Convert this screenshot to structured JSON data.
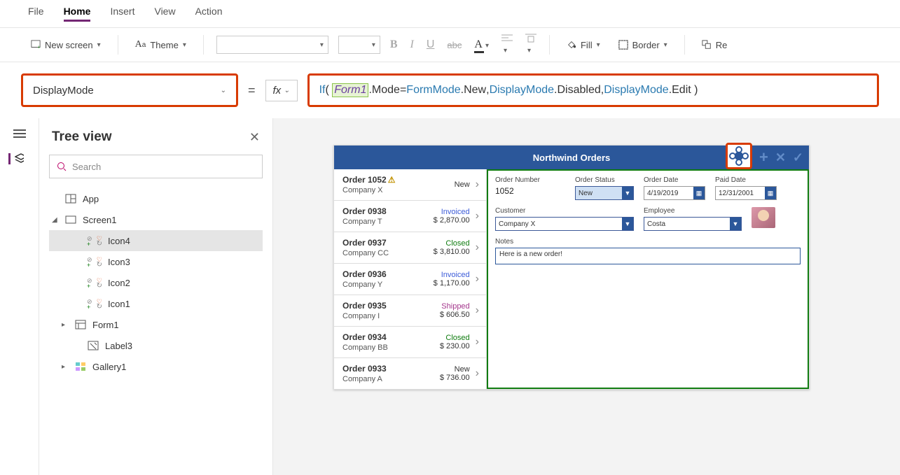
{
  "menu": {
    "items": [
      "File",
      "Home",
      "Insert",
      "View",
      "Action"
    ],
    "active": "Home"
  },
  "ribbon": {
    "new_screen": "New screen",
    "theme": "Theme",
    "fill": "Fill",
    "border": "Border",
    "re": "Re"
  },
  "property": {
    "selected": "DisplayMode"
  },
  "fx_label": "fx",
  "formula": {
    "fn": "If",
    "ref": "Form1",
    "p1a": ".Mode",
    "eq": " = ",
    "e1": "FormMode",
    "e1m": ".New",
    "c1": ", ",
    "e2": "DisplayMode",
    "e2m": ".Disabled",
    "c2": ", ",
    "e3": "DisplayMode",
    "e3m": ".Edit"
  },
  "tree": {
    "title": "Tree view",
    "search_ph": "Search",
    "app": "App",
    "screen": "Screen1",
    "items": [
      "Icon4",
      "Icon3",
      "Icon2",
      "Icon1",
      "Form1",
      "Label3",
      "Gallery1"
    ]
  },
  "appview": {
    "title": "Northwind Orders",
    "orders": [
      {
        "num": "Order 1052",
        "warn": true,
        "company": "Company X",
        "status": "New",
        "statusClass": "s-new",
        "amount": ""
      },
      {
        "num": "Order 0938",
        "company": "Company T",
        "status": "Invoiced",
        "statusClass": "s-invoiced",
        "amount": "$ 2,870.00"
      },
      {
        "num": "Order 0937",
        "company": "Company CC",
        "status": "Closed",
        "statusClass": "s-closed",
        "amount": "$ 3,810.00"
      },
      {
        "num": "Order 0936",
        "company": "Company Y",
        "status": "Invoiced",
        "statusClass": "s-invoiced",
        "amount": "$ 1,170.00"
      },
      {
        "num": "Order 0935",
        "company": "Company I",
        "status": "Shipped",
        "statusClass": "s-shipped",
        "amount": "$ 606.50"
      },
      {
        "num": "Order 0934",
        "company": "Company BB",
        "status": "Closed",
        "statusClass": "s-closed",
        "amount": "$ 230.00"
      },
      {
        "num": "Order 0933",
        "company": "Company A",
        "status": "New",
        "statusClass": "s-new",
        "amount": "$ 736.00"
      }
    ],
    "form": {
      "order_number_lbl": "Order Number",
      "order_number": "1052",
      "order_status_lbl": "Order Status",
      "order_status": "New",
      "order_date_lbl": "Order Date",
      "order_date": "4/19/2019",
      "paid_date_lbl": "Paid Date",
      "paid_date": "12/31/2001",
      "customer_lbl": "Customer",
      "customer": "Company X",
      "employee_lbl": "Employee",
      "employee": "Costa",
      "notes_lbl": "Notes",
      "notes": "Here is a new order!"
    }
  }
}
